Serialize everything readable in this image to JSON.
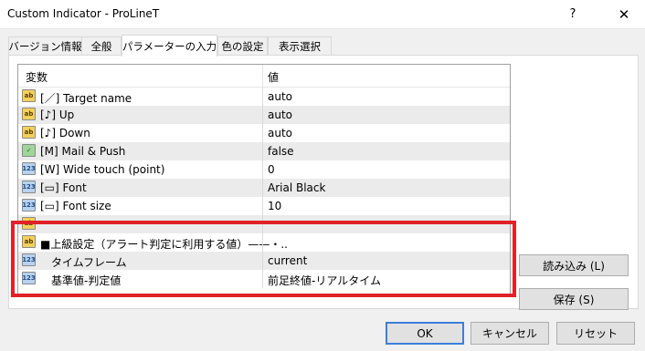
{
  "window": {
    "title": "Custom Indicator - ProLineT",
    "help": "?",
    "close": "✕"
  },
  "tabs": [
    {
      "label": "バージョン情報"
    },
    {
      "label": "全般"
    },
    {
      "label": "パラメーターの入力"
    },
    {
      "label": "色の設定"
    },
    {
      "label": "表示選択"
    }
  ],
  "grid": {
    "headers": {
      "variable": "変数",
      "value": "値"
    },
    "rows": [
      {
        "icon": "ab",
        "name": "[／] Target name",
        "value": "auto"
      },
      {
        "icon": "ab",
        "name": "[♪] Up",
        "value": "auto"
      },
      {
        "icon": "ab",
        "name": "[♪] Down",
        "value": "auto"
      },
      {
        "icon": "bool",
        "name": "[M] Mail & Push",
        "value": "false"
      },
      {
        "icon": "123",
        "name": "[W] Wide touch (point)",
        "value": "0"
      },
      {
        "icon": "123",
        "name": "[▭] Font",
        "value": "Arial Black"
      },
      {
        "icon": "123",
        "name": "[▭] Font size",
        "value": "10"
      },
      {
        "icon": "ab",
        "name": "",
        "value": ""
      },
      {
        "icon": "ab",
        "name": "■上級設定（アラート判定に利用する値）——・..",
        "value": ""
      },
      {
        "icon": "123",
        "name": "タイムフレーム",
        "value": "current"
      },
      {
        "icon": "123",
        "name": "基準値-判定値",
        "value": "前足終値-リアルタイム"
      }
    ]
  },
  "buttons": {
    "load": "読み込み (L)",
    "save": "保存 (S)",
    "ok": "OK",
    "cancel": "キャンセル",
    "reset": "リセット"
  },
  "colors": {
    "highlight": "#e02228",
    "default_button_border": "#3d7edb"
  }
}
